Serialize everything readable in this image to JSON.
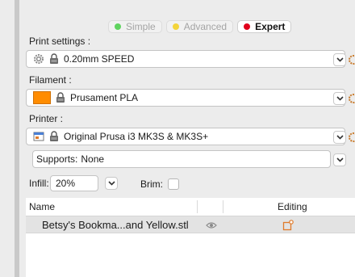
{
  "modes": [
    {
      "label": "Simple",
      "color": "#5fd35f",
      "active": false
    },
    {
      "label": "Advanced",
      "color": "#f3d43a",
      "active": false
    },
    {
      "label": "Expert",
      "color": "#e0001b",
      "active": true
    }
  ],
  "print_settings": {
    "label": "Print settings :",
    "value": "0.20mm SPEED"
  },
  "filament": {
    "label": "Filament :",
    "value": "Prusament PLA",
    "swatch_color": "#ff8c00"
  },
  "printer": {
    "label": "Printer :",
    "value": "Original Prusa i3 MK3S & MK3S+"
  },
  "supports": {
    "label": "Supports:",
    "value": "None"
  },
  "infill": {
    "label": "Infill:",
    "value": "20%"
  },
  "brim": {
    "label": "Brim:",
    "checked": false
  },
  "objects_table": {
    "columns": [
      "Name",
      "Editing"
    ],
    "rows": [
      {
        "name": "Betsy's Bookma...and Yellow.stl"
      }
    ]
  },
  "icons": {
    "gear": "gear-icon",
    "lock": "lock-icon",
    "printer": "printer-icon",
    "chevron": "chevron-down-icon",
    "eye": "eye-icon",
    "edit": "edit-icon"
  }
}
